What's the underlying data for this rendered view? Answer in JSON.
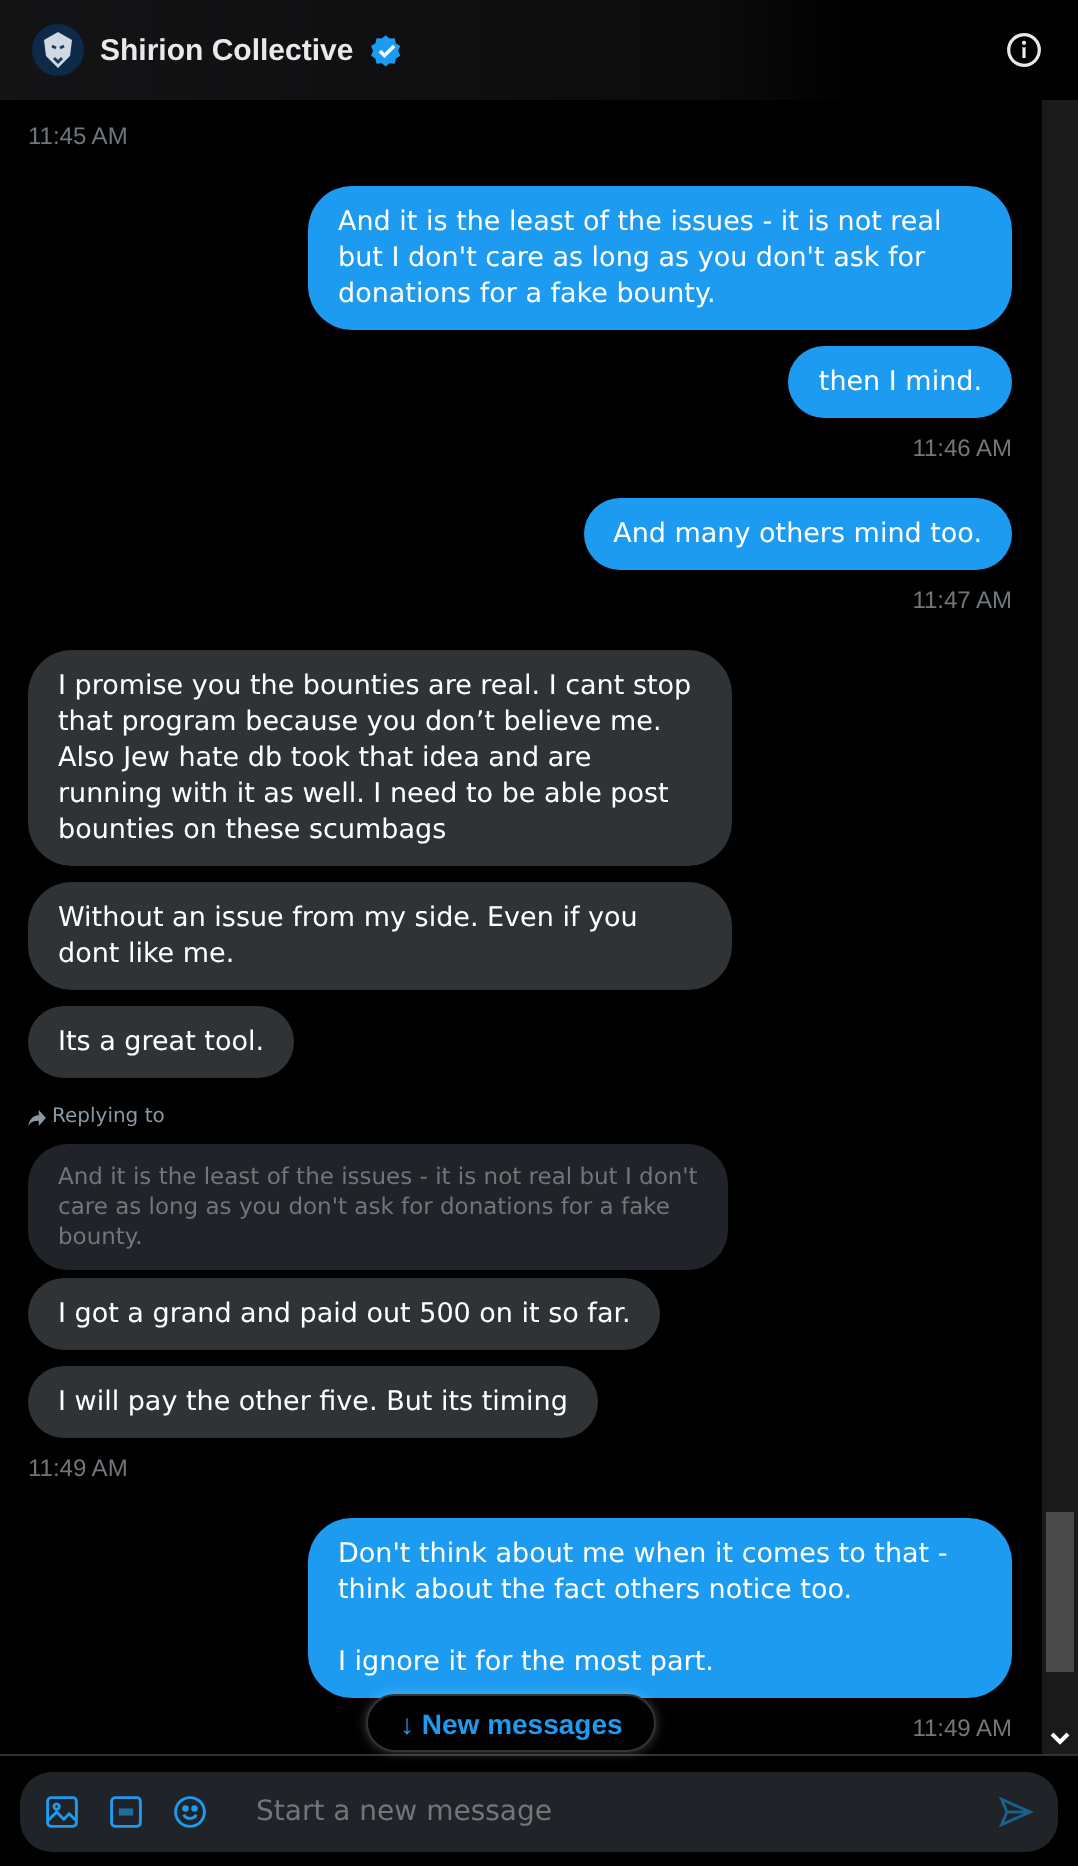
{
  "header": {
    "name": "Shirion Collective",
    "verified": true
  },
  "messages": [
    {
      "kind": "timestamp",
      "outgoing": false,
      "text": "11:45 AM"
    },
    {
      "kind": "message",
      "outgoing": true,
      "text": "And it is the least of the issues - it is not real but I don't care as long as you don't ask for donations for a fake bounty."
    },
    {
      "kind": "message",
      "outgoing": true,
      "text": "then I mind."
    },
    {
      "kind": "timestamp",
      "outgoing": true,
      "text": "11:46 AM"
    },
    {
      "kind": "message",
      "outgoing": true,
      "text": "And many others mind too."
    },
    {
      "kind": "timestamp",
      "outgoing": true,
      "text": "11:47 AM"
    },
    {
      "kind": "message",
      "outgoing": false,
      "text": "I promise you the bounties are real. I cant stop that program because you don’t believe me. Also Jew hate db took that idea and are running with it as well. I need to be able post bounties on these scumbags"
    },
    {
      "kind": "message",
      "outgoing": false,
      "text": "Without an issue from my side. Even if you dont like me."
    },
    {
      "kind": "message",
      "outgoing": false,
      "text": "Its a great tool."
    },
    {
      "kind": "reply",
      "outgoing": false,
      "label": "Replying to",
      "quote": "And it is the least of the issues - it is not real but I don't care as long as you don't ask for donations for a fake bounty.",
      "text": "I got a grand and paid out 500 on it so far."
    },
    {
      "kind": "message",
      "outgoing": false,
      "text": "I will pay the other five. But its timing"
    },
    {
      "kind": "timestamp",
      "outgoing": false,
      "text": "11:49 AM"
    },
    {
      "kind": "message",
      "outgoing": true,
      "text": "Don't think about me when it comes to that - think about the fact others notice too.\n\nI ignore it for the most part."
    },
    {
      "kind": "timestamp",
      "outgoing": true,
      "text": "11:49 AM"
    }
  ],
  "new_messages": "↓ New messages",
  "composer": {
    "placeholder": "Start a new message"
  }
}
